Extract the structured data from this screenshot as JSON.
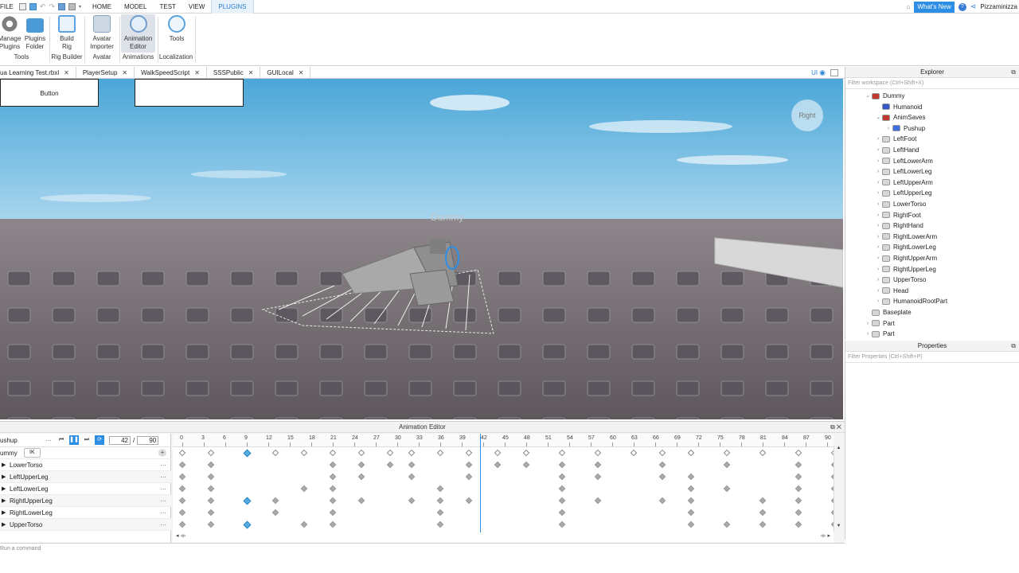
{
  "menubar": {
    "file": "FILE",
    "tabs": [
      "HOME",
      "MODEL",
      "TEST",
      "VIEW",
      "PLUGINS"
    ],
    "active_tab": "PLUGINS",
    "whats_new": "What's New",
    "username": "Pizzaminizza"
  },
  "ribbon": {
    "buttons": [
      {
        "label1": "Manage",
        "label2": "Plugins"
      },
      {
        "label1": "Plugins",
        "label2": "Folder"
      },
      {
        "label1": "Build",
        "label2": "Rig"
      },
      {
        "label1": "Avatar",
        "label2": "Importer"
      },
      {
        "label1": "Animation",
        "label2": "Editor"
      },
      {
        "label1": "Tools",
        "label2": ""
      }
    ],
    "groups": [
      "Tools",
      "Rig Builder",
      "Avatar",
      "Animations",
      "Localization"
    ]
  },
  "doc_tabs": [
    "ua Learning Test.rbxl",
    "PlayerSetup",
    "WalkSpeedScript",
    "SSSPublic",
    "GUILocal"
  ],
  "doc_tabs_right": {
    "ui": "UI"
  },
  "viewport": {
    "gui_button": "Button",
    "dummy_label": "Dummy",
    "nav_label": "Right"
  },
  "explorer": {
    "title": "Explorer",
    "filter": "Filter workspace (Ctrl+Shift+X)",
    "items": [
      {
        "label": "Dummy",
        "depth": 1,
        "arrow": "v"
      },
      {
        "label": "Humanoid",
        "depth": 2,
        "arrow": ""
      },
      {
        "label": "AnimSaves",
        "depth": 2,
        "arrow": "v"
      },
      {
        "label": "Pushup",
        "depth": 3,
        "arrow": ">"
      },
      {
        "label": "LeftFoot",
        "depth": 2,
        "arrow": ">"
      },
      {
        "label": "LeftHand",
        "depth": 2,
        "arrow": ">"
      },
      {
        "label": "LeftLowerArm",
        "depth": 2,
        "arrow": ">"
      },
      {
        "label": "LeftLowerLeg",
        "depth": 2,
        "arrow": ">"
      },
      {
        "label": "LeftUpperArm",
        "depth": 2,
        "arrow": ">"
      },
      {
        "label": "LeftUpperLeg",
        "depth": 2,
        "arrow": ">"
      },
      {
        "label": "LowerTorso",
        "depth": 2,
        "arrow": ">"
      },
      {
        "label": "RightFoot",
        "depth": 2,
        "arrow": ">"
      },
      {
        "label": "RightHand",
        "depth": 2,
        "arrow": ">"
      },
      {
        "label": "RightLowerArm",
        "depth": 2,
        "arrow": ">"
      },
      {
        "label": "RightLowerLeg",
        "depth": 2,
        "arrow": ">"
      },
      {
        "label": "RightUpperArm",
        "depth": 2,
        "arrow": ">"
      },
      {
        "label": "RightUpperLeg",
        "depth": 2,
        "arrow": ">"
      },
      {
        "label": "UpperTorso",
        "depth": 2,
        "arrow": ">"
      },
      {
        "label": "Head",
        "depth": 2,
        "arrow": ">"
      },
      {
        "label": "HumanoidRootPart",
        "depth": 2,
        "arrow": ">"
      },
      {
        "label": "Baseplate",
        "depth": 1,
        "arrow": ""
      },
      {
        "label": "Part",
        "depth": 1,
        "arrow": ">"
      },
      {
        "label": "Part",
        "depth": 1,
        "arrow": ">"
      }
    ]
  },
  "properties": {
    "title": "Properties",
    "filter": "Filter Properties (Ctrl+Shift+P)"
  },
  "anim_editor": {
    "title": "Animation Editor",
    "anim_name": "ushup",
    "rig": "ummy",
    "ik": "IK",
    "current_frame": "42",
    "separator": "/",
    "total_frames": "90",
    "tracks": [
      "LowerTorso",
      "LeftUpperLeg",
      "LeftLowerLeg",
      "RightUpperLeg",
      "RightLowerLeg",
      "UpperTorso"
    ],
    "ruler_labels": [
      "0",
      "3",
      "6",
      "9",
      "12",
      "15",
      "18",
      "21",
      "24",
      "27",
      "30",
      "33",
      "36",
      "39",
      "42",
      "45",
      "48",
      "51",
      "54",
      "57",
      "60",
      "63",
      "66",
      "69",
      "72",
      "75",
      "78",
      "81",
      "84",
      "87",
      "90"
    ],
    "scrubber_frame": 41.5,
    "keyframes": {
      "summary": [
        0,
        4,
        9,
        13,
        17,
        21,
        25,
        29,
        32,
        36,
        40,
        44,
        48,
        53,
        58,
        63,
        67,
        71,
        76,
        81,
        86,
        91
      ],
      "LowerTorso": [
        0,
        4,
        21,
        25,
        29,
        32,
        40,
        44,
        48,
        53,
        58,
        67,
        76,
        86,
        91
      ],
      "LeftUpperLeg": [
        0,
        4,
        21,
        25,
        32,
        40,
        53,
        58,
        67,
        71,
        86,
        91
      ],
      "LeftLowerLeg": [
        0,
        4,
        17,
        21,
        36,
        53,
        71,
        76,
        86,
        91
      ],
      "RightUpperLeg": [
        0,
        4,
        9,
        13,
        21,
        25,
        32,
        36,
        40,
        53,
        58,
        67,
        71,
        81,
        86,
        91
      ],
      "RightLowerLeg": [
        0,
        4,
        13,
        21,
        36,
        53,
        71,
        81,
        86,
        91
      ],
      "UpperTorso": [
        0,
        4,
        9,
        17,
        21,
        36,
        53,
        71,
        76,
        81,
        86,
        91
      ]
    },
    "selected": {
      "summary": [
        9
      ],
      "RightUpperLeg": [
        9
      ],
      "UpperTorso": [
        9
      ]
    }
  },
  "command_bar": {
    "placeholder": "Run a command"
  },
  "colors": {
    "accent": "#2d8ee6",
    "sky": "#6fb8e0",
    "ground": "#726c70"
  }
}
